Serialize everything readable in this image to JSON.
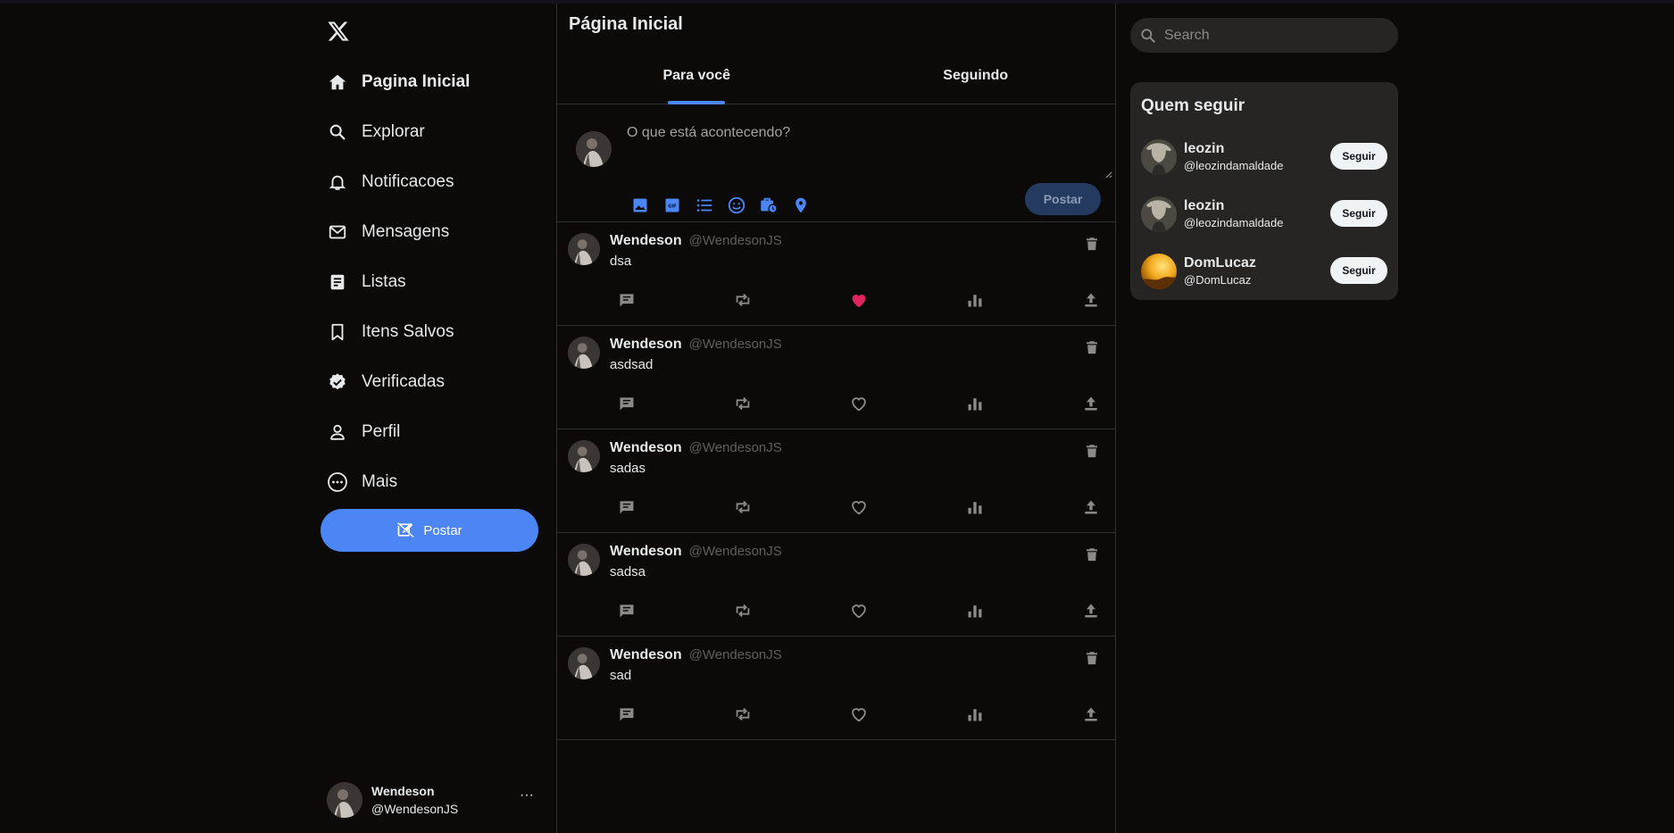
{
  "brand": {
    "logo_icon": "x-logo-icon"
  },
  "sidebar": {
    "items": [
      {
        "label": "Pagina Inicial",
        "icon": "home-icon",
        "active": true
      },
      {
        "label": "Explorar",
        "icon": "search-icon"
      },
      {
        "label": "Notificacoes",
        "icon": "bell-icon"
      },
      {
        "label": "Mensagens",
        "icon": "mail-icon"
      },
      {
        "label": "Listas",
        "icon": "list-icon"
      },
      {
        "label": "Itens Salvos",
        "icon": "bookmark-icon"
      },
      {
        "label": "Verificadas",
        "icon": "verified-icon"
      },
      {
        "label": "Perfil",
        "icon": "person-icon"
      },
      {
        "label": "Mais",
        "icon": "more-circle-icon"
      }
    ],
    "post_button_label": "Postar",
    "profile": {
      "name": "Wendeson",
      "handle": "@WendesonJS",
      "more_label": "···"
    }
  },
  "main": {
    "title": "Página Inicial",
    "tabs": [
      {
        "label": "Para você",
        "active": true
      },
      {
        "label": "Seguindo",
        "active": false
      }
    ],
    "composer": {
      "placeholder": "O que está acontecendo?",
      "tools": [
        "image-icon",
        "gif-icon",
        "poll-icon",
        "emoji-icon",
        "schedule-icon",
        "location-icon"
      ],
      "post_label": "Postar"
    },
    "tweets": [
      {
        "name": "Wendeson",
        "handle": "@WendesonJS",
        "text": "dsa",
        "liked": true
      },
      {
        "name": "Wendeson",
        "handle": "@WendesonJS",
        "text": "asdsad",
        "liked": false
      },
      {
        "name": "Wendeson",
        "handle": "@WendesonJS",
        "text": "sadas",
        "liked": false
      },
      {
        "name": "Wendeson",
        "handle": "@WendesonJS",
        "text": "sadsa",
        "liked": false
      },
      {
        "name": "Wendeson",
        "handle": "@WendesonJS",
        "text": "sad",
        "liked": false
      }
    ]
  },
  "right": {
    "search_placeholder": "Search",
    "who_to_follow": {
      "title": "Quem seguir",
      "follow_label": "Seguir",
      "users": [
        {
          "name": "leozin",
          "handle": "@leozindamaldade"
        },
        {
          "name": "leozin",
          "handle": "@leozindamaldade"
        },
        {
          "name": "DomLucaz",
          "handle": "@DomLucaz"
        }
      ]
    }
  },
  "colors": {
    "accent": "#4c86f5",
    "like": "#e0245e",
    "background": "#0b0a09",
    "card": "#272523",
    "muted_text": "#5e5e5e"
  }
}
